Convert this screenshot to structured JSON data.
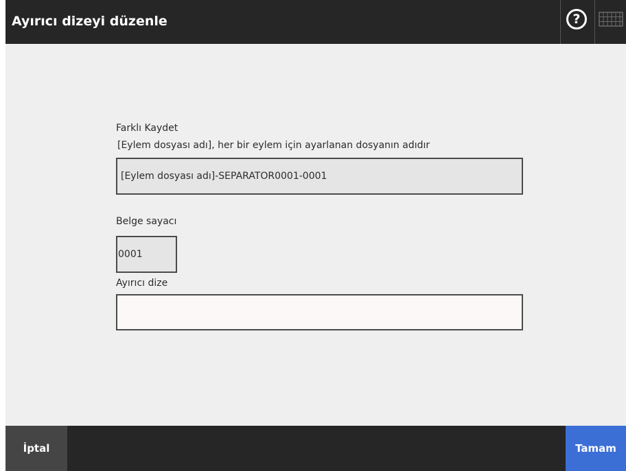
{
  "window": {
    "title": "Ayırıcı dizeyi düzenle",
    "help_symbol": "?"
  },
  "icons": {
    "help": "question-mark-circle-icon",
    "keyboard": "keyboard-icon"
  },
  "form": {
    "save_as": {
      "label": "Farklı Kaydet",
      "hint": "[Eylem dosyası adı], her bir eylem için ayarlanan dosyanın adıdır",
      "value": "[Eylem dosyası adı]-SEPARATOR0001-0001"
    },
    "document_counter": {
      "label": "Belge sayacı",
      "value": "0001"
    },
    "separator_string": {
      "label": "Ayırıcı dize",
      "value": ""
    }
  },
  "footer": {
    "cancel_label": "İptal",
    "ok_label": "Tamam"
  },
  "colors": {
    "titlebar": "#262626",
    "background": "#efefef",
    "readonly_field": "#e6e5e6",
    "editable_field": "#fdf8f8",
    "cancel_button": "#454545",
    "ok_button": "#3b6fd6"
  }
}
